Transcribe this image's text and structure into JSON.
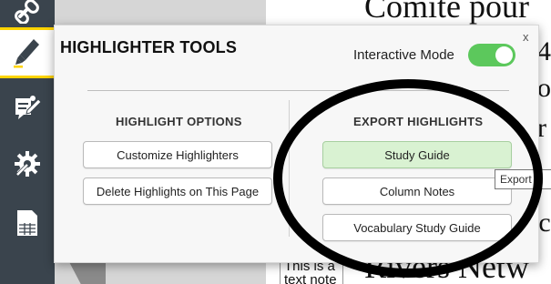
{
  "document": {
    "line_top": "Comite pour",
    "line_bottom": "Rivers Netw",
    "note_text": "This is a text note",
    "edge_fragments": [
      "4",
      "o",
      "r",
      "ic"
    ]
  },
  "toolbar": {
    "items": [
      {
        "icon": "link-icon"
      },
      {
        "icon": "highlighter-pen-icon",
        "active": true
      },
      {
        "icon": "note-edit-icon"
      },
      {
        "icon": "settings-wrench-icon"
      },
      {
        "icon": "table-grid-icon"
      }
    ],
    "active_color": "#ffd400"
  },
  "panel": {
    "title": "HIGHLIGHTER TOOLS",
    "close_label": "x",
    "interactive_mode": {
      "label": "Interactive Mode",
      "on": true,
      "color": "#5cc85c"
    },
    "highlight_options": {
      "title": "HIGHLIGHT OPTIONS",
      "buttons": [
        "Customize Highlighters",
        "Delete Highlights on This Page"
      ]
    },
    "export_highlights": {
      "title": "EXPORT HIGHLIGHTS",
      "buttons": [
        "Study Guide",
        "Column Notes",
        "Vocabulary Study Guide"
      ],
      "selected_color": "#d9f2d2"
    }
  },
  "tooltip": {
    "text": "Export hi"
  }
}
